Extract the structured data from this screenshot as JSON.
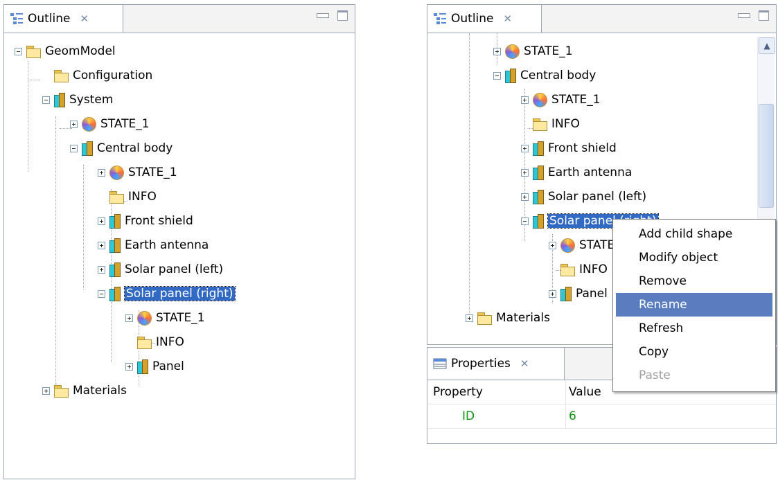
{
  "left": {
    "tab": {
      "label": "Outline"
    },
    "tree": [
      {
        "label": "GeomModel"
      },
      {
        "label": "Configuration"
      },
      {
        "label": "System"
      },
      {
        "label": "STATE_1"
      },
      {
        "label": "Central body"
      },
      {
        "label": "STATE_1"
      },
      {
        "label": "INFO"
      },
      {
        "label": "Front shield"
      },
      {
        "label": "Earth antenna"
      },
      {
        "label": "Solar panel (left)"
      },
      {
        "label": "Solar panel (right)"
      },
      {
        "label": "STATE_1"
      },
      {
        "label": "INFO"
      },
      {
        "label": "Panel"
      },
      {
        "label": "Materials"
      }
    ]
  },
  "right": {
    "tab": {
      "label": "Outline"
    },
    "tree": [
      {
        "label": "STATE_1"
      },
      {
        "label": "Central body"
      },
      {
        "label": "STATE_1"
      },
      {
        "label": "INFO"
      },
      {
        "label": "Front shield"
      },
      {
        "label": "Earth antenna"
      },
      {
        "label": "Solar panel (left)"
      },
      {
        "label": "Solar panel (right)"
      },
      {
        "label": "STATE_1"
      },
      {
        "label": "INFO"
      },
      {
        "label": "Panel"
      },
      {
        "label": "Materials"
      }
    ],
    "properties": {
      "tab": "Properties",
      "columns": [
        "Property",
        "Value"
      ],
      "rows": [
        {
          "property": "ID",
          "value": "6"
        }
      ]
    },
    "context_menu": {
      "items": [
        {
          "label": "Add child shape",
          "state": "normal"
        },
        {
          "label": "Modify object",
          "state": "normal"
        },
        {
          "label": "Remove",
          "state": "normal"
        },
        {
          "label": "Rename",
          "state": "highlighted"
        },
        {
          "label": "Refresh",
          "state": "normal"
        },
        {
          "label": "Copy",
          "state": "normal"
        },
        {
          "label": "Paste",
          "state": "disabled"
        }
      ]
    }
  }
}
